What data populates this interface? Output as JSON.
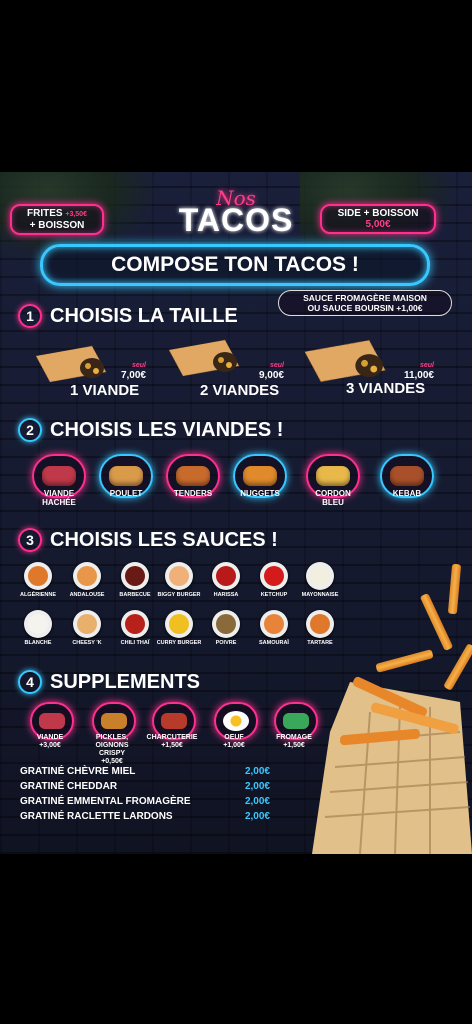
{
  "header": {
    "left_pill": {
      "line1": "FRITES",
      "price": "+3,50€",
      "line2": "+ BOISSON"
    },
    "right_pill": {
      "line1": "SIDE + BOISSON",
      "price": "5,00€"
    },
    "nos": "Nos",
    "tacos": "TACOS",
    "compose": "COMPOSE TON TACOS !"
  },
  "step1": {
    "num": "1",
    "title": "CHOISIS LA TAILLE",
    "sauce_note": {
      "line1": "SAUCE FROMAGÈRE MAISON",
      "line2": "OU SAUCE BOURSIN +1,00€"
    },
    "sizes": [
      {
        "seul": "seul",
        "price": "7,00€",
        "label": "1 VIANDE"
      },
      {
        "seul": "seul",
        "price": "9,00€",
        "label": "2 VIANDES"
      },
      {
        "seul": "seul",
        "price": "11,00€",
        "label": "3 VIANDES"
      }
    ]
  },
  "step2": {
    "num": "2",
    "title": "CHOISIS LES VIANDES !",
    "meats": [
      {
        "label": "VIANDE",
        "label2": "HACHÉE",
        "icon": "ground-meat-icon",
        "color": "#c0394a"
      },
      {
        "label": "POULET",
        "label2": "",
        "icon": "chicken-strips-icon",
        "color": "#d99a4a"
      },
      {
        "label": "TENDERS",
        "label2": "",
        "icon": "tenders-icon",
        "color": "#c86a2c"
      },
      {
        "label": "NUGGETS",
        "label2": "",
        "icon": "nuggets-icon",
        "color": "#e08a2c"
      },
      {
        "label": "CORDON",
        "label2": "BLEU",
        "icon": "cordon-bleu-icon",
        "color": "#e8b84a"
      },
      {
        "label": "KEBAB",
        "label2": "",
        "icon": "kebab-icon",
        "color": "#a8502a"
      }
    ]
  },
  "step3": {
    "num": "3",
    "title": "CHOISIS LES SAUCES !",
    "sauces": [
      {
        "label": "ALGÉRIENNE",
        "color": "#e0782c"
      },
      {
        "label": "ANDALOUSE",
        "color": "#e8964a"
      },
      {
        "label": "BARBECUE",
        "color": "#6a1a14"
      },
      {
        "label": "BIGGY BURGER",
        "color": "#f0b07a"
      },
      {
        "label": "HARISSA",
        "color": "#b81a1a"
      },
      {
        "label": "KETCHUP",
        "color": "#d41a1a"
      },
      {
        "label": "MAYONNAISE",
        "color": "#f3efe0"
      },
      {
        "label": "BLANCHE",
        "color": "#f5f3ee"
      },
      {
        "label": "CHEESY 'K",
        "color": "#e8b06a"
      },
      {
        "label": "CHILI THAÏ",
        "color": "#b8201a"
      },
      {
        "label": "CURRY BURGER",
        "color": "#f0c020"
      },
      {
        "label": "POIVRE",
        "color": "#8a6a3a"
      },
      {
        "label": "SAMOURAÏ",
        "color": "#e8843a"
      },
      {
        "label": "TARTARE",
        "color": "#e0782c"
      }
    ]
  },
  "step4": {
    "num": "4",
    "title": "SUPPLEMENTS",
    "items": [
      {
        "label": "VIANDE",
        "price": "+3,00€",
        "icon": "ground-meat-icon",
        "color": "#c0394a"
      },
      {
        "label": "PICKLES, OIGNONS CRISPY",
        "price": "+0,50€",
        "icon": "crispy-onions-icon",
        "color": "#c8802a"
      },
      {
        "label": "CHARCUTERIE",
        "price": "+1,50€",
        "icon": "bacon-icon",
        "color": "#b83a2a"
      },
      {
        "label": "OEUF",
        "price": "+1,00€",
        "icon": "egg-icon",
        "color": "#f5c020"
      },
      {
        "label": "FROMAGE",
        "price": "+1,50€",
        "icon": "cheese-icon",
        "color": "#3aa85a"
      }
    ],
    "gratines": [
      {
        "label": "GRATINÉ CHÈVRE MIEL",
        "price": "2,00€"
      },
      {
        "label": "GRATINÉ CHEDDAR",
        "price": "2,00€"
      },
      {
        "label": "GRATINÉ EMMENTAL FROMAGÈRE",
        "price": "2,00€"
      },
      {
        "label": "GRATINÉ RACLETTE LARDONS",
        "price": "2,00€"
      }
    ]
  },
  "colors": {
    "neon_pink": "#ff2f8f",
    "neon_blue": "#38c8ff",
    "price_blue": "#38c8ff"
  }
}
